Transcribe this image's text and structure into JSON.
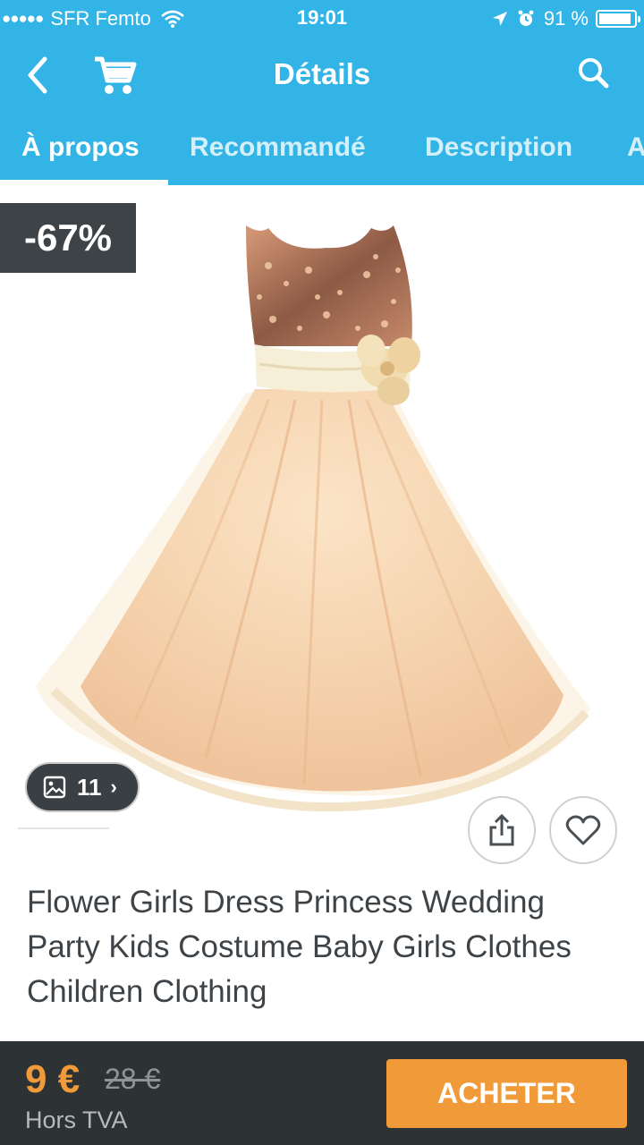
{
  "status_bar": {
    "signal_dots": "●●●●●",
    "carrier": "SFR Femto",
    "time": "19:01",
    "battery_percent": "91 %",
    "battery_level": 0.91
  },
  "navbar": {
    "title": "Détails",
    "back_icon": "chevron-left-icon",
    "cart_icon": "cart-icon",
    "search_icon": "search-icon"
  },
  "tabs": [
    {
      "label": "À propos",
      "active": true
    },
    {
      "label": "Recommandé",
      "active": false
    },
    {
      "label": "Description",
      "active": false
    },
    {
      "label": "A",
      "active": false
    }
  ],
  "product": {
    "discount": "-67%",
    "image_count": "11",
    "title": "Flower Girls Dress Princess Wedding Party Kids Costume Baby Girls Clothes Children Clothing"
  },
  "purchase": {
    "price": "9 €",
    "old_price": "28 €",
    "tax_note": "Hors TVA",
    "buy_label": "ACHETER"
  },
  "colors": {
    "header": "#33b4e6",
    "accent": "#f19a39",
    "bottom_bar": "#2d3234",
    "badge": "#3d4346"
  }
}
